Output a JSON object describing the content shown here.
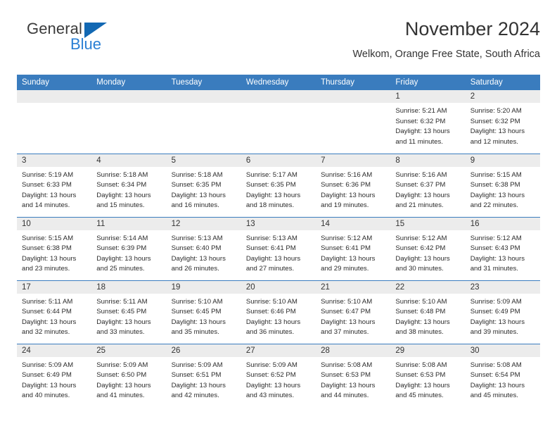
{
  "brand": {
    "name_top": "General",
    "name_bottom": "Blue",
    "triangle_color": "#1268b3",
    "blue_text_color": "#2a7fd4"
  },
  "header": {
    "title": "November 2024",
    "subtitle": "Welkom, Orange Free State, South Africa"
  },
  "theme": {
    "header_blue": "#3a7cbe",
    "daynum_gray": "#ececec",
    "text": "#333333"
  },
  "weekday_headers": [
    "Sunday",
    "Monday",
    "Tuesday",
    "Wednesday",
    "Thursday",
    "Friday",
    "Saturday"
  ],
  "labels": {
    "sunrise_prefix": "Sunrise:",
    "sunset_prefix": "Sunset:",
    "daylight_prefix": "Daylight:"
  },
  "weeks": [
    [
      {
        "day": "",
        "blank": true
      },
      {
        "day": "",
        "blank": true
      },
      {
        "day": "",
        "blank": true
      },
      {
        "day": "",
        "blank": true
      },
      {
        "day": "",
        "blank": true
      },
      {
        "day": "1",
        "sunrise": "Sunrise: 5:21 AM",
        "sunset": "Sunset: 6:32 PM",
        "daylight": "Daylight: 13 hours and 11 minutes."
      },
      {
        "day": "2",
        "sunrise": "Sunrise: 5:20 AM",
        "sunset": "Sunset: 6:32 PM",
        "daylight": "Daylight: 13 hours and 12 minutes."
      }
    ],
    [
      {
        "day": "3",
        "sunrise": "Sunrise: 5:19 AM",
        "sunset": "Sunset: 6:33 PM",
        "daylight": "Daylight: 13 hours and 14 minutes."
      },
      {
        "day": "4",
        "sunrise": "Sunrise: 5:18 AM",
        "sunset": "Sunset: 6:34 PM",
        "daylight": "Daylight: 13 hours and 15 minutes."
      },
      {
        "day": "5",
        "sunrise": "Sunrise: 5:18 AM",
        "sunset": "Sunset: 6:35 PM",
        "daylight": "Daylight: 13 hours and 16 minutes."
      },
      {
        "day": "6",
        "sunrise": "Sunrise: 5:17 AM",
        "sunset": "Sunset: 6:35 PM",
        "daylight": "Daylight: 13 hours and 18 minutes."
      },
      {
        "day": "7",
        "sunrise": "Sunrise: 5:16 AM",
        "sunset": "Sunset: 6:36 PM",
        "daylight": "Daylight: 13 hours and 19 minutes."
      },
      {
        "day": "8",
        "sunrise": "Sunrise: 5:16 AM",
        "sunset": "Sunset: 6:37 PM",
        "daylight": "Daylight: 13 hours and 21 minutes."
      },
      {
        "day": "9",
        "sunrise": "Sunrise: 5:15 AM",
        "sunset": "Sunset: 6:38 PM",
        "daylight": "Daylight: 13 hours and 22 minutes."
      }
    ],
    [
      {
        "day": "10",
        "sunrise": "Sunrise: 5:15 AM",
        "sunset": "Sunset: 6:38 PM",
        "daylight": "Daylight: 13 hours and 23 minutes."
      },
      {
        "day": "11",
        "sunrise": "Sunrise: 5:14 AM",
        "sunset": "Sunset: 6:39 PM",
        "daylight": "Daylight: 13 hours and 25 minutes."
      },
      {
        "day": "12",
        "sunrise": "Sunrise: 5:13 AM",
        "sunset": "Sunset: 6:40 PM",
        "daylight": "Daylight: 13 hours and 26 minutes."
      },
      {
        "day": "13",
        "sunrise": "Sunrise: 5:13 AM",
        "sunset": "Sunset: 6:41 PM",
        "daylight": "Daylight: 13 hours and 27 minutes."
      },
      {
        "day": "14",
        "sunrise": "Sunrise: 5:12 AM",
        "sunset": "Sunset: 6:41 PM",
        "daylight": "Daylight: 13 hours and 29 minutes."
      },
      {
        "day": "15",
        "sunrise": "Sunrise: 5:12 AM",
        "sunset": "Sunset: 6:42 PM",
        "daylight": "Daylight: 13 hours and 30 minutes."
      },
      {
        "day": "16",
        "sunrise": "Sunrise: 5:12 AM",
        "sunset": "Sunset: 6:43 PM",
        "daylight": "Daylight: 13 hours and 31 minutes."
      }
    ],
    [
      {
        "day": "17",
        "sunrise": "Sunrise: 5:11 AM",
        "sunset": "Sunset: 6:44 PM",
        "daylight": "Daylight: 13 hours and 32 minutes."
      },
      {
        "day": "18",
        "sunrise": "Sunrise: 5:11 AM",
        "sunset": "Sunset: 6:45 PM",
        "daylight": "Daylight: 13 hours and 33 minutes."
      },
      {
        "day": "19",
        "sunrise": "Sunrise: 5:10 AM",
        "sunset": "Sunset: 6:45 PM",
        "daylight": "Daylight: 13 hours and 35 minutes."
      },
      {
        "day": "20",
        "sunrise": "Sunrise: 5:10 AM",
        "sunset": "Sunset: 6:46 PM",
        "daylight": "Daylight: 13 hours and 36 minutes."
      },
      {
        "day": "21",
        "sunrise": "Sunrise: 5:10 AM",
        "sunset": "Sunset: 6:47 PM",
        "daylight": "Daylight: 13 hours and 37 minutes."
      },
      {
        "day": "22",
        "sunrise": "Sunrise: 5:10 AM",
        "sunset": "Sunset: 6:48 PM",
        "daylight": "Daylight: 13 hours and 38 minutes."
      },
      {
        "day": "23",
        "sunrise": "Sunrise: 5:09 AM",
        "sunset": "Sunset: 6:49 PM",
        "daylight": "Daylight: 13 hours and 39 minutes."
      }
    ],
    [
      {
        "day": "24",
        "sunrise": "Sunrise: 5:09 AM",
        "sunset": "Sunset: 6:49 PM",
        "daylight": "Daylight: 13 hours and 40 minutes."
      },
      {
        "day": "25",
        "sunrise": "Sunrise: 5:09 AM",
        "sunset": "Sunset: 6:50 PM",
        "daylight": "Daylight: 13 hours and 41 minutes."
      },
      {
        "day": "26",
        "sunrise": "Sunrise: 5:09 AM",
        "sunset": "Sunset: 6:51 PM",
        "daylight": "Daylight: 13 hours and 42 minutes."
      },
      {
        "day": "27",
        "sunrise": "Sunrise: 5:09 AM",
        "sunset": "Sunset: 6:52 PM",
        "daylight": "Daylight: 13 hours and 43 minutes."
      },
      {
        "day": "28",
        "sunrise": "Sunrise: 5:08 AM",
        "sunset": "Sunset: 6:53 PM",
        "daylight": "Daylight: 13 hours and 44 minutes."
      },
      {
        "day": "29",
        "sunrise": "Sunrise: 5:08 AM",
        "sunset": "Sunset: 6:53 PM",
        "daylight": "Daylight: 13 hours and 45 minutes."
      },
      {
        "day": "30",
        "sunrise": "Sunrise: 5:08 AM",
        "sunset": "Sunset: 6:54 PM",
        "daylight": "Daylight: 13 hours and 45 minutes."
      }
    ]
  ]
}
